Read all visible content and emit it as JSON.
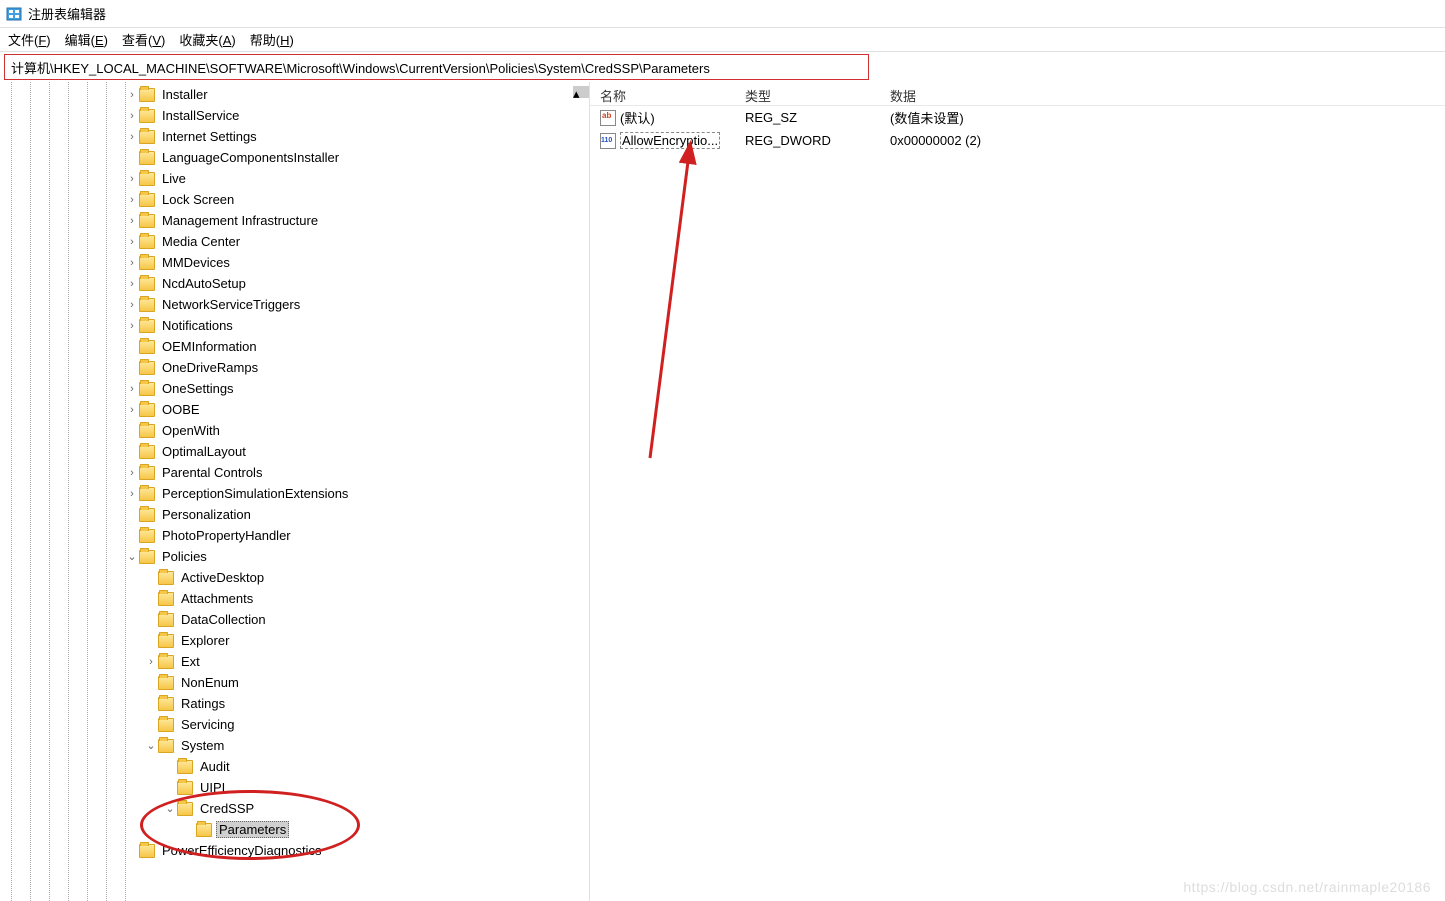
{
  "window": {
    "title": "注册表编辑器"
  },
  "menubar": [
    {
      "label": "文件(F)",
      "hot": "F"
    },
    {
      "label": "编辑(E)",
      "hot": "E"
    },
    {
      "label": "查看(V)",
      "hot": "V"
    },
    {
      "label": "收藏夹(A)",
      "hot": "A"
    },
    {
      "label": "帮助(H)",
      "hot": "H"
    }
  ],
  "address": "计算机\\HKEY_LOCAL_MACHINE\\SOFTWARE\\Microsoft\\Windows\\CurrentVersion\\Policies\\System\\CredSSP\\Parameters",
  "tree": [
    {
      "indent": 7,
      "expand": ">",
      "label": "Installer"
    },
    {
      "indent": 7,
      "expand": ">",
      "label": "InstallService"
    },
    {
      "indent": 7,
      "expand": ">",
      "label": "Internet Settings"
    },
    {
      "indent": 7,
      "expand": "",
      "label": "LanguageComponentsInstaller"
    },
    {
      "indent": 7,
      "expand": ">",
      "label": "Live"
    },
    {
      "indent": 7,
      "expand": ">",
      "label": "Lock Screen"
    },
    {
      "indent": 7,
      "expand": ">",
      "label": "Management Infrastructure"
    },
    {
      "indent": 7,
      "expand": ">",
      "label": "Media Center"
    },
    {
      "indent": 7,
      "expand": ">",
      "label": "MMDevices"
    },
    {
      "indent": 7,
      "expand": ">",
      "label": "NcdAutoSetup"
    },
    {
      "indent": 7,
      "expand": ">",
      "label": "NetworkServiceTriggers"
    },
    {
      "indent": 7,
      "expand": ">",
      "label": "Notifications"
    },
    {
      "indent": 7,
      "expand": "",
      "label": "OEMInformation"
    },
    {
      "indent": 7,
      "expand": "",
      "label": "OneDriveRamps"
    },
    {
      "indent": 7,
      "expand": ">",
      "label": "OneSettings"
    },
    {
      "indent": 7,
      "expand": ">",
      "label": "OOBE"
    },
    {
      "indent": 7,
      "expand": "",
      "label": "OpenWith"
    },
    {
      "indent": 7,
      "expand": "",
      "label": "OptimalLayout"
    },
    {
      "indent": 7,
      "expand": ">",
      "label": "Parental Controls"
    },
    {
      "indent": 7,
      "expand": ">",
      "label": "PerceptionSimulationExtensions"
    },
    {
      "indent": 7,
      "expand": "",
      "label": "Personalization"
    },
    {
      "indent": 7,
      "expand": "",
      "label": "PhotoPropertyHandler"
    },
    {
      "indent": 7,
      "expand": "v",
      "label": "Policies"
    },
    {
      "indent": 8,
      "expand": "",
      "label": "ActiveDesktop"
    },
    {
      "indent": 8,
      "expand": "",
      "label": "Attachments"
    },
    {
      "indent": 8,
      "expand": "",
      "label": "DataCollection"
    },
    {
      "indent": 8,
      "expand": "",
      "label": "Explorer"
    },
    {
      "indent": 8,
      "expand": ">",
      "label": "Ext"
    },
    {
      "indent": 8,
      "expand": "",
      "label": "NonEnum"
    },
    {
      "indent": 8,
      "expand": "",
      "label": "Ratings"
    },
    {
      "indent": 8,
      "expand": "",
      "label": "Servicing"
    },
    {
      "indent": 8,
      "expand": "v",
      "label": "System"
    },
    {
      "indent": 9,
      "expand": "",
      "label": "Audit"
    },
    {
      "indent": 9,
      "expand": "",
      "label": "UIPI"
    },
    {
      "indent": 9,
      "expand": "v",
      "label": "CredSSP"
    },
    {
      "indent": 10,
      "expand": "",
      "label": "Parameters",
      "selected": true
    },
    {
      "indent": 7,
      "expand": "",
      "label": "PowerEfficiencyDiagnostics"
    }
  ],
  "list": {
    "headers": {
      "name": "名称",
      "type": "类型",
      "data": "数据"
    },
    "rows": [
      {
        "icon": "sz",
        "name": "(默认)",
        "type": "REG_SZ",
        "data": "(数值未设置)",
        "selected": false
      },
      {
        "icon": "dw",
        "name": "AllowEncryptio...",
        "type": "REG_DWORD",
        "data": "0x00000002 (2)",
        "selected": true
      }
    ]
  },
  "watermark": "https://blog.csdn.net/rainmaple20186"
}
